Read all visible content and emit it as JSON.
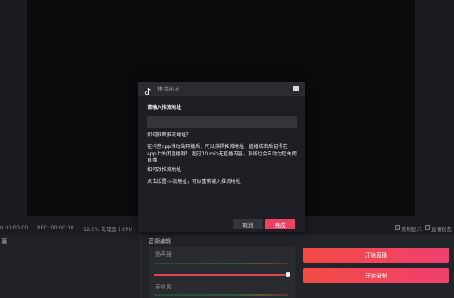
{
  "status": {
    "time": "0 00:00:00",
    "rec": "REC: 00:00:00",
    "cpu": "12.0% 处理器 ( CPU )",
    "chk1": "录制显示",
    "chk2": "直播状态"
  },
  "left_panel": {
    "title": "源"
  },
  "audio": {
    "title": "音频编辑",
    "speaker": "扬声器",
    "mic": "麦克风"
  },
  "actions": {
    "start_live": "开始直播",
    "start_record": "开始录制"
  },
  "dialog": {
    "title": "推流地址",
    "prompt": "请输入推流地址",
    "input_value": "",
    "q1": "如何获取推流地址？",
    "a1": "在抖音app移动端开播后，可以获得推流地址，直播结束后记得在app上关闭直播哦！ 超过10 min无直播内容，系统也会自动为您关闭直播",
    "q2": "如何改推流地址",
    "a2": "点击设置->流地址，可以重新输入推流地址",
    "cancel": "取消",
    "confirm": "完成"
  },
  "colors": {
    "accent_start": "#f14b44",
    "accent_end": "#f0406e",
    "confirm": "#ef3f64"
  }
}
